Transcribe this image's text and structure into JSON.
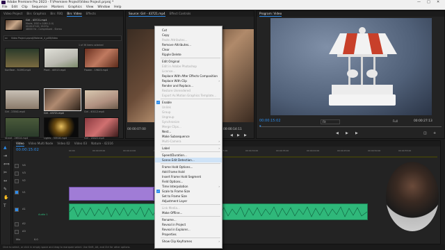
{
  "window": {
    "title": "Adobe Premiere Pro 2023 - F:\\Premiere Project\\Video Project.prproj *",
    "controls": [
      "—",
      "□",
      "✕"
    ]
  },
  "menubar": [
    "File",
    "Edit",
    "Clip",
    "Sequence",
    "Markers",
    "Graphics",
    "View",
    "Window",
    "Help"
  ],
  "project_panel": {
    "tabs": [
      "Video Project",
      "Bin: Graphics",
      "Bin: FBQ",
      "Bin: Video",
      "Effects"
    ],
    "active_tab": "Bin: Video",
    "clip_name": "Girl - 43721.mp4",
    "clip_info_1": "Movie, 1920 x 1080 (1.0)",
    "clip_info_2": "00:00:07:00, 29.97p",
    "clip_info_3": "48000 Hz - Compressed - Stereo",
    "path": "Video Project.prproj\\Material_4_p4B\\Video",
    "items_count": "1 of 36 items selected",
    "thumbs": [
      {
        "label": "Sunflare - 51093.mp4",
        "dur": "0:08"
      },
      {
        "label": "Plant - 40513.mp4",
        "dur": "0:06"
      },
      {
        "label": "Flower - 19823.mp4",
        "dur": "0:09"
      },
      {
        "label": "Girl - 23541.mp4",
        "dur": "0:12"
      },
      {
        "label": "Girl - 40112.mp4",
        "dur": "0:07"
      },
      {
        "label": "Girl - 43721.mp4",
        "dur": "0:07"
      },
      {
        "label": "Girl - 33012.mp4",
        "dur": "0:10"
      },
      {
        "label": "Street - 26514.mp4",
        "dur": "0:05"
      },
      {
        "label": "Lights - 33516.mp4",
        "dur": "0:06"
      },
      {
        "label": "Girl - 18422.mp4",
        "dur": "0:08"
      }
    ]
  },
  "source_panel": {
    "tabs": [
      "Source: Girl - 43721.mp4",
      "Effect Controls"
    ],
    "timecode_left": "00:00:07:00",
    "timecode_right": "00:00:14:11"
  },
  "program_panel": {
    "tab": "Program: Video",
    "timecode": "00:00:15:02",
    "fit": "Fit",
    "resolution": "Full",
    "duration": "00:00:27:13"
  },
  "timeline": {
    "sequence_tabs": [
      "Video",
      "Video Multi Node",
      "Video 02",
      "Video 03",
      "Nature - 42316"
    ],
    "timecode": "00:00:15:02",
    "ruler": [
      "00:00",
      "00:00:05:00",
      "00:00:10:00",
      "00:00:15:00",
      "00:00:20:00",
      "00:00:25:00",
      "00:00:30:00",
      "00:00:35:00",
      "00:00:40:00",
      "00:00:45:00",
      "00:00:50:00",
      "00:00:55:00",
      "00:01:00:00"
    ],
    "video_tracks": [
      "V4",
      "V3",
      "V2",
      "V1"
    ],
    "audio_tracks": [
      "A1",
      "A2",
      "A3"
    ],
    "audio_label": "Audio 1",
    "master": "Mix",
    "master_value": "0.0",
    "accent_video": "#a07cd6",
    "accent_audio": "#2fb87a"
  },
  "context_menu": {
    "highlighted": "Scene Edit Detection...",
    "items": [
      {
        "label": "Cut",
        "enabled": true
      },
      {
        "label": "Copy",
        "enabled": true
      },
      {
        "label": "Paste Attributes...",
        "enabled": false
      },
      {
        "label": "Remove Attributes...",
        "enabled": true
      },
      {
        "label": "Clear",
        "enabled": true
      },
      {
        "label": "Ripple Delete",
        "enabled": true
      },
      {
        "sep": true
      },
      {
        "label": "Edit Original",
        "enabled": true
      },
      {
        "label": "Edit in Adobe Photoshop",
        "enabled": false
      },
      {
        "label": "License...",
        "enabled": false
      },
      {
        "label": "Replace With After Effects Composition",
        "enabled": true
      },
      {
        "label": "Replace With Clip",
        "enabled": true,
        "submenu": true
      },
      {
        "label": "Render and Replace...",
        "enabled": true
      },
      {
        "label": "Restore Unrendered",
        "enabled": false
      },
      {
        "label": "Export As Motion Graphics Template...",
        "enabled": false
      },
      {
        "sep": true
      },
      {
        "label": "Enable",
        "enabled": true,
        "checked": true
      },
      {
        "label": "Unlink",
        "enabled": false
      },
      {
        "label": "Group",
        "enabled": false
      },
      {
        "label": "Ungroup",
        "enabled": false
      },
      {
        "label": "Synchronize",
        "enabled": false
      },
      {
        "label": "Merge Clips...",
        "enabled": false
      },
      {
        "label": "Nest...",
        "enabled": true
      },
      {
        "label": "Make Subsequence",
        "enabled": true
      },
      {
        "label": "Multi-Camera",
        "enabled": false,
        "submenu": true
      },
      {
        "sep": true
      },
      {
        "label": "Label",
        "enabled": true,
        "submenu": true
      },
      {
        "sep": true
      },
      {
        "label": "Speed/Duration...",
        "enabled": true
      },
      {
        "label": "Scene Edit Detection...",
        "enabled": true
      },
      {
        "sep": true
      },
      {
        "label": "Frame Hold Options...",
        "enabled": true
      },
      {
        "label": "Add Frame Hold",
        "enabled": true
      },
      {
        "label": "Insert Frame Hold Segment",
        "enabled": true
      },
      {
        "label": "Field Options...",
        "enabled": true
      },
      {
        "label": "Time Interpolation",
        "enabled": true,
        "submenu": true
      },
      {
        "label": "Scale to Frame Size",
        "enabled": true,
        "checked": true
      },
      {
        "label": "Set to Frame Size",
        "enabled": true
      },
      {
        "label": "Adjustment Layer",
        "enabled": true
      },
      {
        "sep": true
      },
      {
        "label": "Link Media...",
        "enabled": false
      },
      {
        "label": "Make Offline...",
        "enabled": true
      },
      {
        "sep": true
      },
      {
        "label": "Rename...",
        "enabled": true
      },
      {
        "label": "Reveal in Project",
        "enabled": true
      },
      {
        "label": "Reveal in Explorer...",
        "enabled": true
      },
      {
        "label": "Properties",
        "enabled": true
      },
      {
        "sep": true
      },
      {
        "label": "Show Clip Keyframes",
        "enabled": true,
        "submenu": true
      }
    ]
  },
  "status": "Click to select, or click in empty space and drag to marquee select. Use Shift, Alt, and Ctrl for other options."
}
